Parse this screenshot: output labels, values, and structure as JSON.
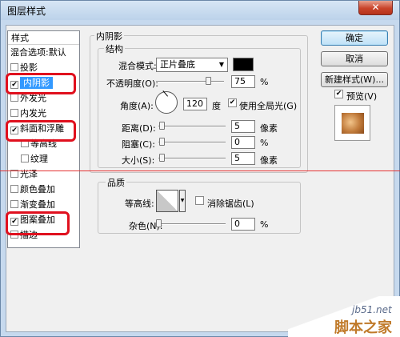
{
  "window": {
    "title": "图层样式",
    "close_glyph": "✕"
  },
  "left_panel": {
    "header": "样式",
    "items": [
      {
        "label": "混合选项:默认",
        "checkbox": false,
        "checked": false,
        "indent": false
      },
      {
        "label": "投影",
        "checkbox": true,
        "checked": false,
        "indent": false
      },
      {
        "label": "内阴影",
        "checkbox": true,
        "checked": true,
        "indent": false,
        "selected": true
      },
      {
        "label": "外发光",
        "checkbox": true,
        "checked": false,
        "indent": false
      },
      {
        "label": "内发光",
        "checkbox": true,
        "checked": false,
        "indent": false
      },
      {
        "label": "斜面和浮雕",
        "checkbox": true,
        "checked": true,
        "indent": false
      },
      {
        "label": "等高线",
        "checkbox": true,
        "checked": false,
        "indent": true
      },
      {
        "label": "纹理",
        "checkbox": true,
        "checked": false,
        "indent": true
      },
      {
        "label": "光泽",
        "checkbox": true,
        "checked": false,
        "indent": false
      },
      {
        "label": "颜色叠加",
        "checkbox": true,
        "checked": false,
        "indent": false
      },
      {
        "label": "渐变叠加",
        "checkbox": true,
        "checked": false,
        "indent": false
      },
      {
        "label": "图案叠加",
        "checkbox": true,
        "checked": true,
        "indent": false
      },
      {
        "label": "描边",
        "checkbox": true,
        "checked": false,
        "indent": false
      }
    ]
  },
  "inner_shadow": {
    "section_title": "内阴影",
    "structure": {
      "title": "结构",
      "blend_mode_label": "混合模式:",
      "blend_mode_value": "正片叠底",
      "opacity_label": "不透明度(O):",
      "opacity_value": "75",
      "opacity_unit": "%",
      "angle_label": "角度(A):",
      "angle_value": "120",
      "angle_unit": "度",
      "global_light_label": "使用全局光(G)",
      "global_light_checked": true,
      "distance_label": "距离(D):",
      "distance_value": "5",
      "distance_unit": "像素",
      "choke_label": "阻塞(C):",
      "choke_value": "0",
      "choke_unit": "%",
      "size_label": "大小(S):",
      "size_value": "5",
      "size_unit": "像素"
    },
    "quality": {
      "title": "品质",
      "contour_label": "等高线:",
      "antialias_label": "消除锯齿(L)",
      "noise_label": "杂色(N):",
      "noise_value": "0",
      "noise_unit": "%"
    }
  },
  "buttons": {
    "ok": "确定",
    "cancel": "取消",
    "new_style": "新建样式(W)...",
    "preview": "预览(V)"
  },
  "colors": {
    "shadow_color": "#000000",
    "selection": "#3399ff",
    "highlight_box": "#e0101e"
  },
  "watermark": {
    "site": "jb51.net",
    "name": "脚本之家"
  }
}
